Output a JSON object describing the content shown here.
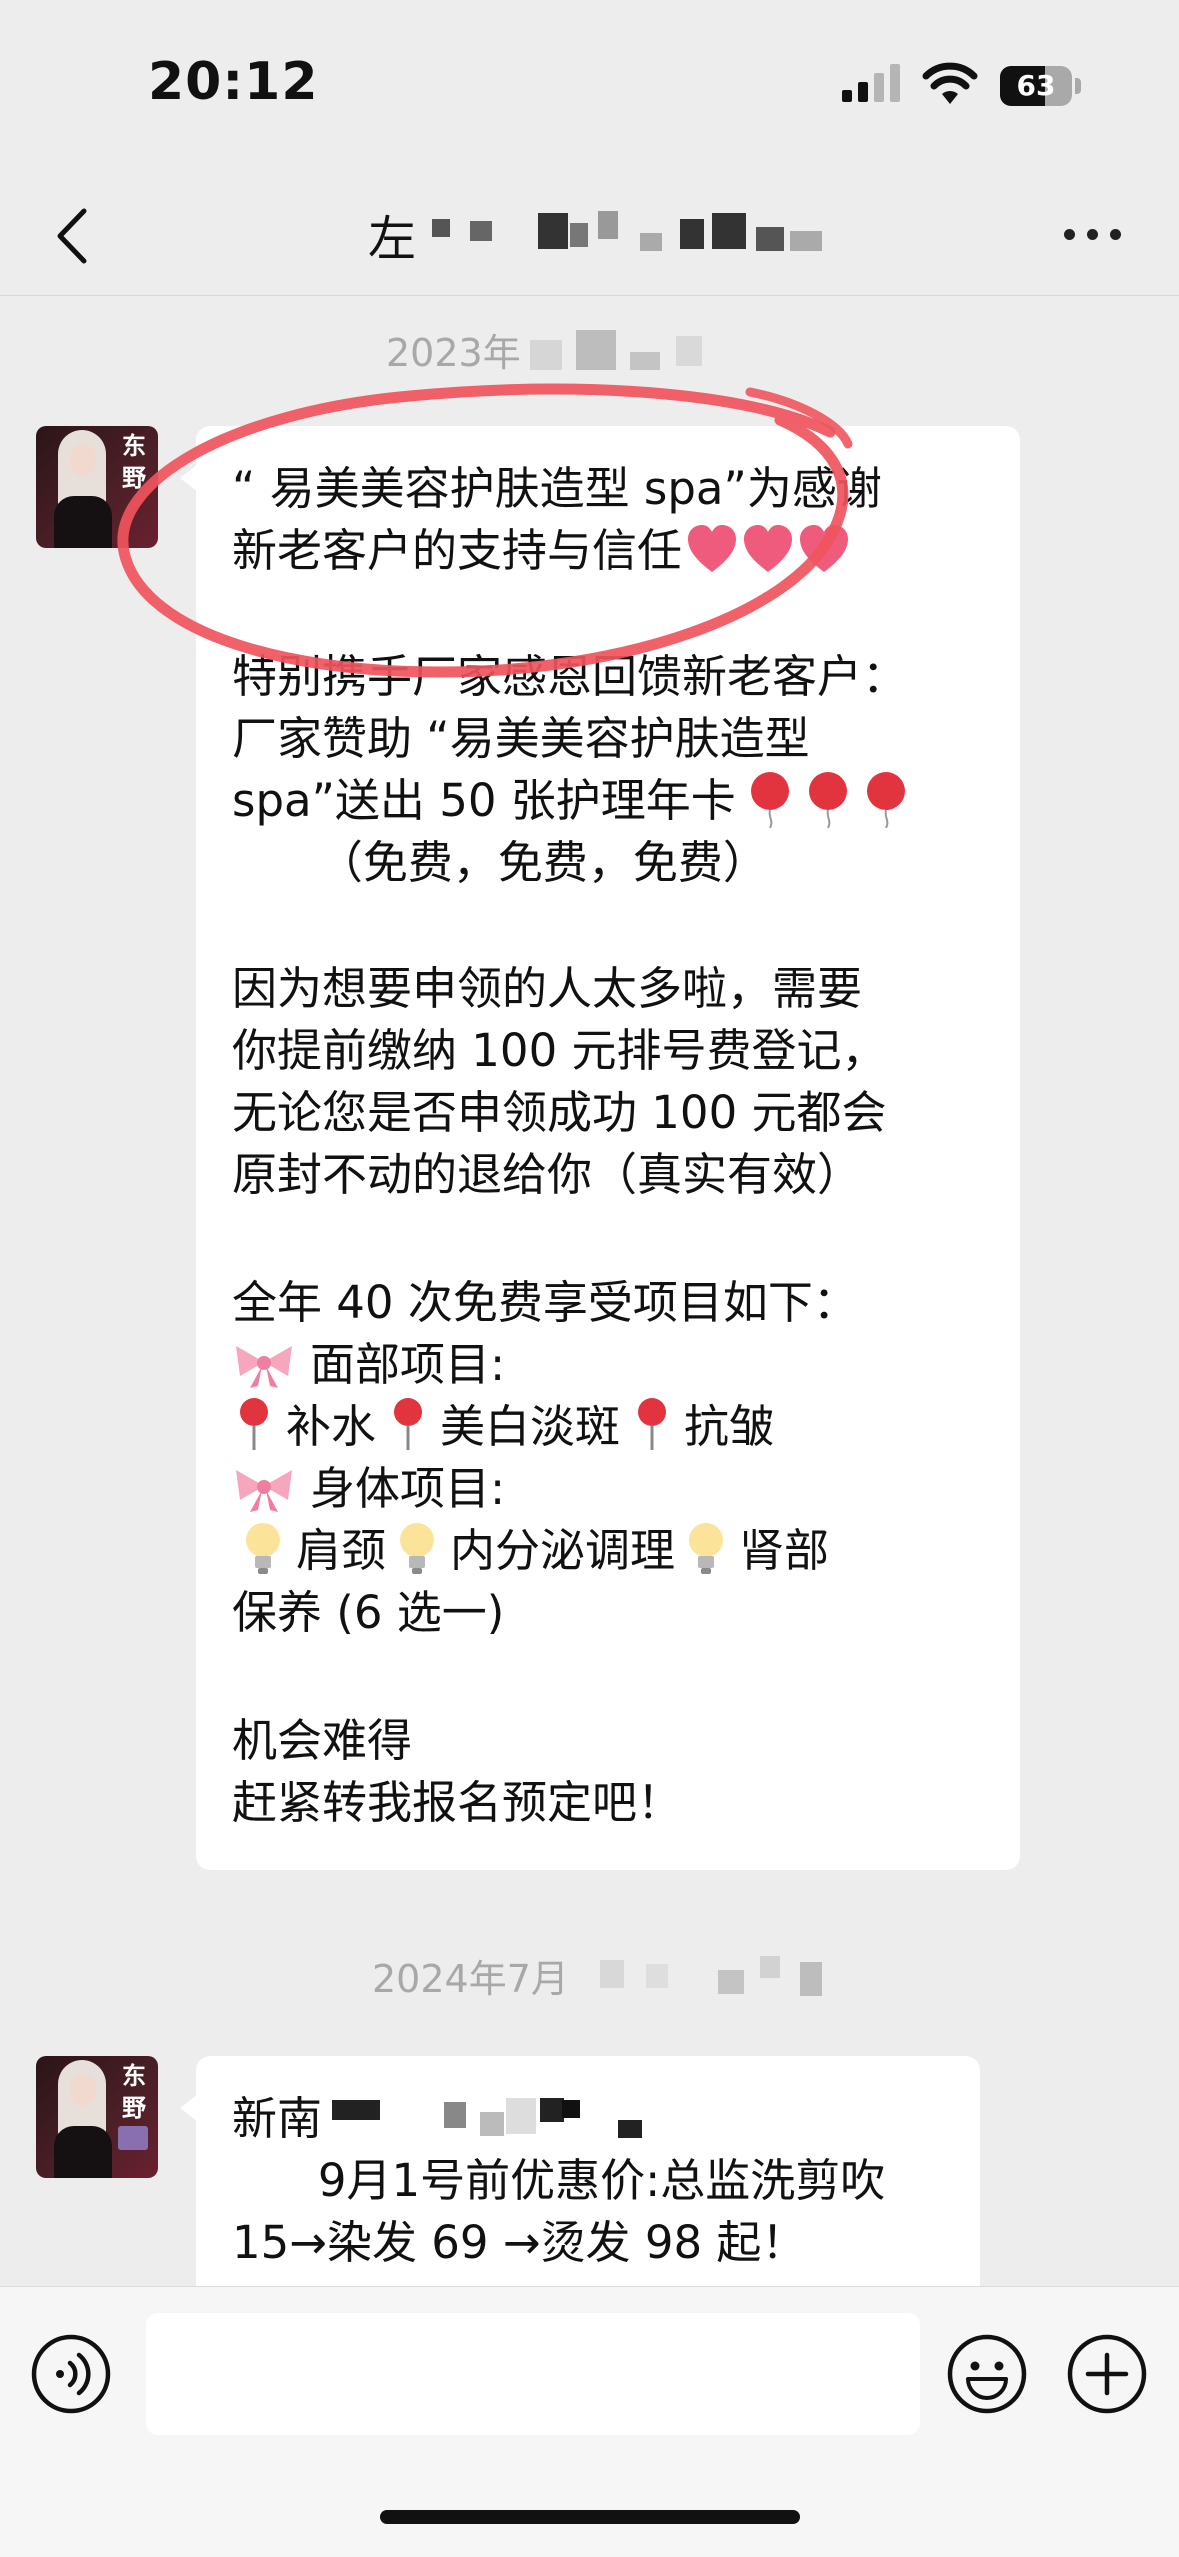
{
  "status_bar": {
    "time": "20:12",
    "battery": "63"
  },
  "header": {
    "title": "左"
  },
  "timestamps": [
    "2023年",
    "2024年7月"
  ],
  "messages": [
    {
      "sender_tag": "东野",
      "lines": [
        "“ 易美美容护肤造型 spa”为感谢",
        "新老客户的支持与信任",
        "",
        "特别携手厂家感恩回馈新老客户：",
        "厂家赞助 “易美美容护肤造型",
        "spa”送出 50 张护理年卡",
        "      （免费，免费，免费）",
        "",
        "因为想要申领的人太多啦，需要",
        "你提前缴纳 100 元排号费登记，",
        "无论您是否申领成功 100 元都会",
        "原封不动的退给你（真实有效）",
        "",
        "全年 40 次免费享受项目如下：",
        "面部项目:",
        "补水",
        "美白淡斑",
        "抗皱",
        "身体项目:",
        "肩颈",
        "内分泌调理",
        "肾部",
        "保养 (6 选一)",
        "",
        "机会难得",
        "赶紧转我报名预定吧！"
      ]
    },
    {
      "sender_tag": "东野",
      "lines": [
        "新南",
        "      9月1号前优惠价:总监洗剪吹",
        "15→染发 69 →烫发 98 起！"
      ]
    }
  ],
  "icons": {
    "back": "chevron-left-icon",
    "more": "more-icon",
    "voice": "voice-icon",
    "emoji": "emoji-icon",
    "plus": "plus-icon"
  },
  "colors": {
    "background": "#ededed",
    "bubble": "#ffffff",
    "annotation": "#f0545c"
  }
}
